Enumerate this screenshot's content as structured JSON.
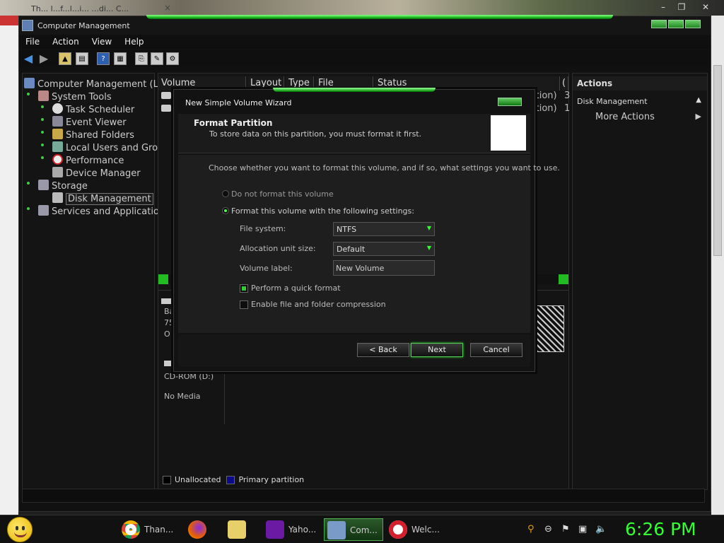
{
  "browser": {
    "tab_text": "Th... l...f...l...i... ...di... C...",
    "close": "×"
  },
  "window": {
    "title": "Computer Management"
  },
  "menu": [
    "File",
    "Action",
    "View",
    "Help"
  ],
  "tree": {
    "root": "Computer Management (Loc",
    "system_tools": "System Tools",
    "task_scheduler": "Task Scheduler",
    "event_viewer": "Event Viewer",
    "shared_folders": "Shared Folders",
    "local_users": "Local Users and Grou",
    "performance": "Performance",
    "device_manager": "Device Manager",
    "storage": "Storage",
    "disk_management": "Disk Management",
    "services": "Services and Application:"
  },
  "list": {
    "columns": [
      "Volume",
      "Layout",
      "Type",
      "File System",
      "Status",
      "("
    ],
    "rows_partial": [
      "ition)",
      "ition)"
    ],
    "row_edge": [
      "3",
      "1"
    ],
    "disk_partial": [
      "Ba",
      "75",
      "O"
    ],
    "cdrom_label": "CD-ROM (D:)",
    "cdrom_media": "No Media"
  },
  "legend": {
    "unallocated": "Unallocated",
    "primary": "Primary partition",
    "unallocated_color": "#000000",
    "primary_color": "#0b0b8a"
  },
  "actions": {
    "header": "Actions",
    "section": "Disk Management",
    "more": "More Actions"
  },
  "wizard": {
    "title": "New Simple Volume Wizard",
    "heading": "Format Partition",
    "subheading": "To store data on this partition, you must format it first.",
    "instruction": "Choose whether you want to format this volume, and if so, what settings you want to use.",
    "opt_no_format": "Do not format this volume",
    "opt_format": "Format this volume with the following settings:",
    "fs_label": "File system:",
    "fs_value": "NTFS",
    "alloc_label": "Allocation unit size:",
    "alloc_value": "Default",
    "vol_label": "Volume label:",
    "vol_value": "New Volume",
    "quick_format": "Perform a quick format",
    "compression": "Enable file and folder compression",
    "back": "< Back",
    "next": "Next",
    "cancel": "Cancel"
  },
  "taskbar": {
    "items": [
      {
        "label": "Than...",
        "icon": "chrome-icon"
      },
      {
        "label": "",
        "icon": "firefox-icon"
      },
      {
        "label": "",
        "icon": "folder-icon"
      },
      {
        "label": "Yaho...",
        "icon": "yahoo-messenger-icon"
      },
      {
        "label": "Com...",
        "icon": "computer-management-icon"
      },
      {
        "label": "Welc...",
        "icon": "opera-icon"
      }
    ],
    "clock": "6:26 PM"
  }
}
